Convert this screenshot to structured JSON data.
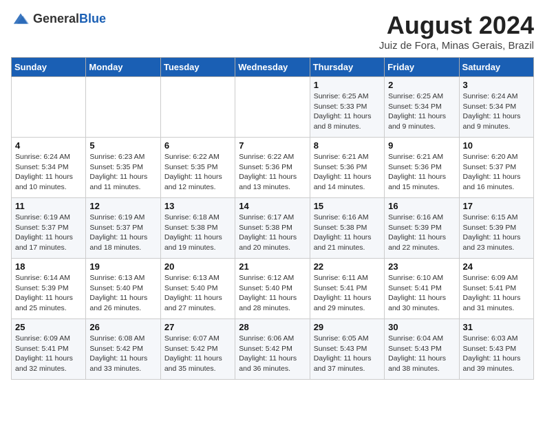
{
  "header": {
    "logo_general": "General",
    "logo_blue": "Blue",
    "month_year": "August 2024",
    "location": "Juiz de Fora, Minas Gerais, Brazil"
  },
  "weekdays": [
    "Sunday",
    "Monday",
    "Tuesday",
    "Wednesday",
    "Thursday",
    "Friday",
    "Saturday"
  ],
  "weeks": [
    [
      {
        "day": "",
        "info": ""
      },
      {
        "day": "",
        "info": ""
      },
      {
        "day": "",
        "info": ""
      },
      {
        "day": "",
        "info": ""
      },
      {
        "day": "1",
        "info": "Sunrise: 6:25 AM\nSunset: 5:33 PM\nDaylight: 11 hours and 8 minutes."
      },
      {
        "day": "2",
        "info": "Sunrise: 6:25 AM\nSunset: 5:34 PM\nDaylight: 11 hours and 9 minutes."
      },
      {
        "day": "3",
        "info": "Sunrise: 6:24 AM\nSunset: 5:34 PM\nDaylight: 11 hours and 9 minutes."
      }
    ],
    [
      {
        "day": "4",
        "info": "Sunrise: 6:24 AM\nSunset: 5:34 PM\nDaylight: 11 hours and 10 minutes."
      },
      {
        "day": "5",
        "info": "Sunrise: 6:23 AM\nSunset: 5:35 PM\nDaylight: 11 hours and 11 minutes."
      },
      {
        "day": "6",
        "info": "Sunrise: 6:22 AM\nSunset: 5:35 PM\nDaylight: 11 hours and 12 minutes."
      },
      {
        "day": "7",
        "info": "Sunrise: 6:22 AM\nSunset: 5:36 PM\nDaylight: 11 hours and 13 minutes."
      },
      {
        "day": "8",
        "info": "Sunrise: 6:21 AM\nSunset: 5:36 PM\nDaylight: 11 hours and 14 minutes."
      },
      {
        "day": "9",
        "info": "Sunrise: 6:21 AM\nSunset: 5:36 PM\nDaylight: 11 hours and 15 minutes."
      },
      {
        "day": "10",
        "info": "Sunrise: 6:20 AM\nSunset: 5:37 PM\nDaylight: 11 hours and 16 minutes."
      }
    ],
    [
      {
        "day": "11",
        "info": "Sunrise: 6:19 AM\nSunset: 5:37 PM\nDaylight: 11 hours and 17 minutes."
      },
      {
        "day": "12",
        "info": "Sunrise: 6:19 AM\nSunset: 5:37 PM\nDaylight: 11 hours and 18 minutes."
      },
      {
        "day": "13",
        "info": "Sunrise: 6:18 AM\nSunset: 5:38 PM\nDaylight: 11 hours and 19 minutes."
      },
      {
        "day": "14",
        "info": "Sunrise: 6:17 AM\nSunset: 5:38 PM\nDaylight: 11 hours and 20 minutes."
      },
      {
        "day": "15",
        "info": "Sunrise: 6:16 AM\nSunset: 5:38 PM\nDaylight: 11 hours and 21 minutes."
      },
      {
        "day": "16",
        "info": "Sunrise: 6:16 AM\nSunset: 5:39 PM\nDaylight: 11 hours and 22 minutes."
      },
      {
        "day": "17",
        "info": "Sunrise: 6:15 AM\nSunset: 5:39 PM\nDaylight: 11 hours and 23 minutes."
      }
    ],
    [
      {
        "day": "18",
        "info": "Sunrise: 6:14 AM\nSunset: 5:39 PM\nDaylight: 11 hours and 25 minutes."
      },
      {
        "day": "19",
        "info": "Sunrise: 6:13 AM\nSunset: 5:40 PM\nDaylight: 11 hours and 26 minutes."
      },
      {
        "day": "20",
        "info": "Sunrise: 6:13 AM\nSunset: 5:40 PM\nDaylight: 11 hours and 27 minutes."
      },
      {
        "day": "21",
        "info": "Sunrise: 6:12 AM\nSunset: 5:40 PM\nDaylight: 11 hours and 28 minutes."
      },
      {
        "day": "22",
        "info": "Sunrise: 6:11 AM\nSunset: 5:41 PM\nDaylight: 11 hours and 29 minutes."
      },
      {
        "day": "23",
        "info": "Sunrise: 6:10 AM\nSunset: 5:41 PM\nDaylight: 11 hours and 30 minutes."
      },
      {
        "day": "24",
        "info": "Sunrise: 6:09 AM\nSunset: 5:41 PM\nDaylight: 11 hours and 31 minutes."
      }
    ],
    [
      {
        "day": "25",
        "info": "Sunrise: 6:09 AM\nSunset: 5:41 PM\nDaylight: 11 hours and 32 minutes."
      },
      {
        "day": "26",
        "info": "Sunrise: 6:08 AM\nSunset: 5:42 PM\nDaylight: 11 hours and 33 minutes."
      },
      {
        "day": "27",
        "info": "Sunrise: 6:07 AM\nSunset: 5:42 PM\nDaylight: 11 hours and 35 minutes."
      },
      {
        "day": "28",
        "info": "Sunrise: 6:06 AM\nSunset: 5:42 PM\nDaylight: 11 hours and 36 minutes."
      },
      {
        "day": "29",
        "info": "Sunrise: 6:05 AM\nSunset: 5:43 PM\nDaylight: 11 hours and 37 minutes."
      },
      {
        "day": "30",
        "info": "Sunrise: 6:04 AM\nSunset: 5:43 PM\nDaylight: 11 hours and 38 minutes."
      },
      {
        "day": "31",
        "info": "Sunrise: 6:03 AM\nSunset: 5:43 PM\nDaylight: 11 hours and 39 minutes."
      }
    ]
  ]
}
